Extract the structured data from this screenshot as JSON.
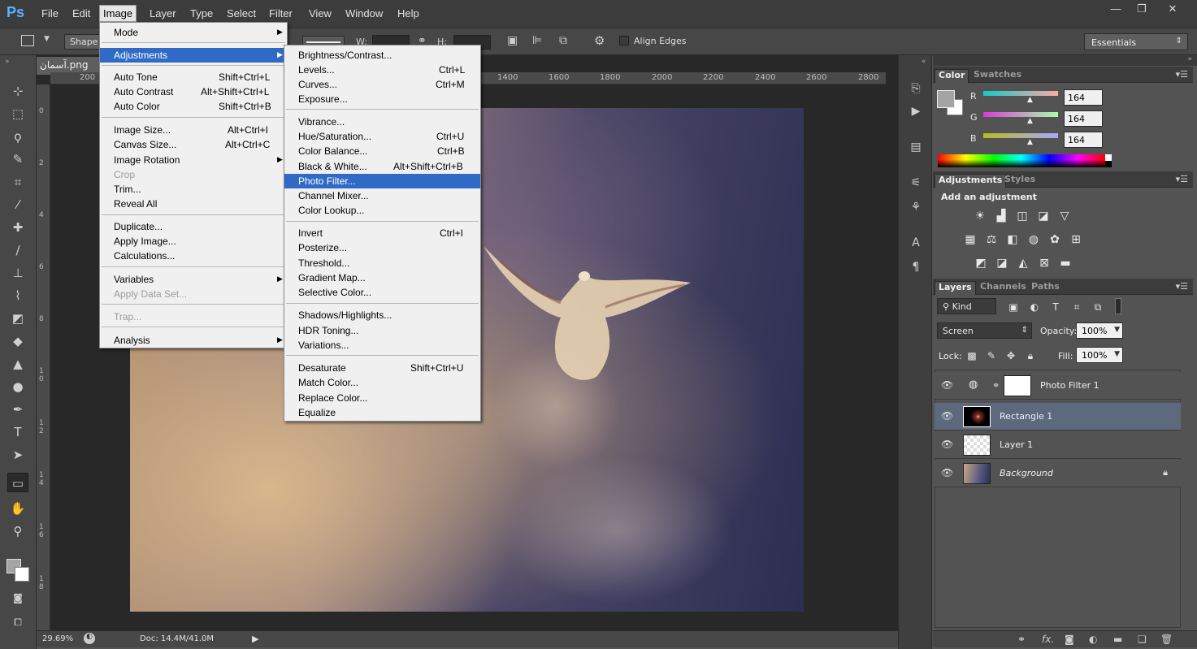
{
  "app": {
    "logo": "Ps"
  },
  "menubar": {
    "items": [
      "File",
      "Edit",
      "Image",
      "Layer",
      "Type",
      "Select",
      "Filter",
      "View",
      "Window",
      "Help"
    ],
    "window_controls": [
      "—",
      "❐",
      "✕"
    ]
  },
  "options": {
    "shape_label": "Shape",
    "w_label": "W:",
    "h_label": "H:",
    "align_edges": "Align Edges",
    "workspace": "Essentials"
  },
  "document": {
    "tab_title": "آسمان.png",
    "zoom": "29.69%",
    "doc_info": "Doc: 14.4M/41.0M",
    "ruler_ticks": [
      "200",
      "1400",
      "1600",
      "1800",
      "2000",
      "2200",
      "2400",
      "2600",
      "2800"
    ],
    "ruler_v_ticks": [
      "0",
      "2",
      "4",
      "6",
      "8",
      "1 0",
      "1 2",
      "1 4",
      "1 6",
      "1 8"
    ]
  },
  "image_menu": {
    "items": [
      {
        "label": "Mode",
        "shortcut": "",
        "submenu": true,
        "disabled": false,
        "highlight": false
      },
      {
        "label": "Adjustments",
        "shortcut": "",
        "submenu": true,
        "disabled": false,
        "highlight": true
      },
      {
        "label": "Auto Tone",
        "shortcut": "Shift+Ctrl+L",
        "submenu": false,
        "disabled": false,
        "highlight": false
      },
      {
        "label": "Auto Contrast",
        "shortcut": "Alt+Shift+Ctrl+L",
        "submenu": false,
        "disabled": false,
        "highlight": false
      },
      {
        "label": "Auto Color",
        "shortcut": "Shift+Ctrl+B",
        "submenu": false,
        "disabled": false,
        "highlight": false
      },
      {
        "label": "Image Size...",
        "shortcut": "Alt+Ctrl+I",
        "submenu": false,
        "disabled": false,
        "highlight": false
      },
      {
        "label": "Canvas Size...",
        "shortcut": "Alt+Ctrl+C",
        "submenu": false,
        "disabled": false,
        "highlight": false
      },
      {
        "label": "Image Rotation",
        "shortcut": "",
        "submenu": true,
        "disabled": false,
        "highlight": false
      },
      {
        "label": "Crop",
        "shortcut": "",
        "submenu": false,
        "disabled": true,
        "highlight": false
      },
      {
        "label": "Trim...",
        "shortcut": "",
        "submenu": false,
        "disabled": false,
        "highlight": false
      },
      {
        "label": "Reveal All",
        "shortcut": "",
        "submenu": false,
        "disabled": false,
        "highlight": false
      },
      {
        "label": "Duplicate...",
        "shortcut": "",
        "submenu": false,
        "disabled": false,
        "highlight": false
      },
      {
        "label": "Apply Image...",
        "shortcut": "",
        "submenu": false,
        "disabled": false,
        "highlight": false
      },
      {
        "label": "Calculations...",
        "shortcut": "",
        "submenu": false,
        "disabled": false,
        "highlight": false
      },
      {
        "label": "Variables",
        "shortcut": "",
        "submenu": true,
        "disabled": false,
        "highlight": false
      },
      {
        "label": "Apply Data Set...",
        "shortcut": "",
        "submenu": false,
        "disabled": true,
        "highlight": false
      },
      {
        "label": "Trap...",
        "shortcut": "",
        "submenu": false,
        "disabled": true,
        "highlight": false
      },
      {
        "label": "Analysis",
        "shortcut": "",
        "submenu": true,
        "disabled": false,
        "highlight": false
      }
    ]
  },
  "adjustments_menu": {
    "items": [
      {
        "label": "Brightness/Contrast...",
        "shortcut": "",
        "highlight": false
      },
      {
        "label": "Levels...",
        "shortcut": "Ctrl+L",
        "highlight": false
      },
      {
        "label": "Curves...",
        "shortcut": "Ctrl+M",
        "highlight": false
      },
      {
        "label": "Exposure...",
        "shortcut": "",
        "highlight": false
      },
      {
        "label": "Vibrance...",
        "shortcut": "",
        "highlight": false
      },
      {
        "label": "Hue/Saturation...",
        "shortcut": "Ctrl+U",
        "highlight": false
      },
      {
        "label": "Color Balance...",
        "shortcut": "Ctrl+B",
        "highlight": false
      },
      {
        "label": "Black & White...",
        "shortcut": "Alt+Shift+Ctrl+B",
        "highlight": false
      },
      {
        "label": "Photo Filter...",
        "shortcut": "",
        "highlight": true
      },
      {
        "label": "Channel Mixer...",
        "shortcut": "",
        "highlight": false
      },
      {
        "label": "Color Lookup...",
        "shortcut": "",
        "highlight": false
      },
      {
        "label": "Invert",
        "shortcut": "Ctrl+I",
        "highlight": false
      },
      {
        "label": "Posterize...",
        "shortcut": "",
        "highlight": false
      },
      {
        "label": "Threshold...",
        "shortcut": "",
        "highlight": false
      },
      {
        "label": "Gradient Map...",
        "shortcut": "",
        "highlight": false
      },
      {
        "label": "Selective Color...",
        "shortcut": "",
        "highlight": false
      },
      {
        "label": "Shadows/Highlights...",
        "shortcut": "",
        "highlight": false
      },
      {
        "label": "HDR Toning...",
        "shortcut": "",
        "highlight": false
      },
      {
        "label": "Variations...",
        "shortcut": "",
        "highlight": false
      },
      {
        "label": "Desaturate",
        "shortcut": "Shift+Ctrl+U",
        "highlight": false
      },
      {
        "label": "Match Color...",
        "shortcut": "",
        "highlight": false
      },
      {
        "label": "Replace Color...",
        "shortcut": "",
        "highlight": false
      },
      {
        "label": "Equalize",
        "shortcut": "",
        "highlight": false
      }
    ]
  },
  "color_panel": {
    "tabs": [
      "Color",
      "Swatches"
    ],
    "channels": [
      {
        "label": "R",
        "value": "164"
      },
      {
        "label": "G",
        "value": "164"
      },
      {
        "label": "B",
        "value": "164"
      }
    ]
  },
  "adjustments_panel": {
    "tabs": [
      "Adjustments",
      "Styles"
    ],
    "heading": "Add an adjustment"
  },
  "layers_panel": {
    "tabs": [
      "Layers",
      "Channels",
      "Paths"
    ],
    "kind_filter": "Kind",
    "blend_mode": "Screen",
    "opacity_label": "Opacity:",
    "opacity": "100%",
    "lock_label": "Lock:",
    "fill_label": "Fill:",
    "fill": "100%",
    "layers": [
      {
        "name": "Photo Filter 1",
        "selected": false
      },
      {
        "name": "Rectangle 1",
        "selected": true
      },
      {
        "name": "Layer 1",
        "selected": false
      },
      {
        "name": "Background",
        "selected": false
      }
    ]
  },
  "colors": {
    "menu_highlight": "#2f6bc6",
    "selected_layer": "#5d6a7e",
    "ps_blue": "#5ab0ff"
  }
}
